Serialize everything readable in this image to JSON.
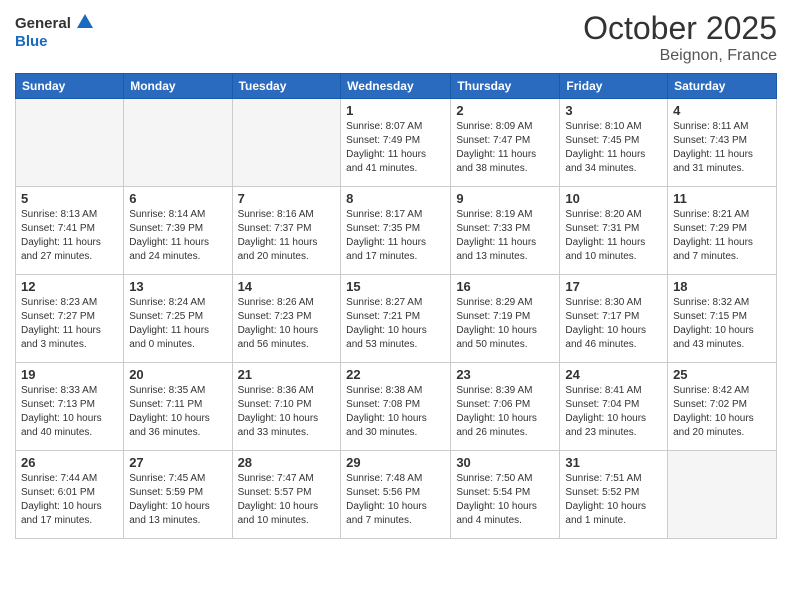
{
  "header": {
    "logo_line1": "General",
    "logo_line2": "Blue",
    "month_title": "October 2025",
    "location": "Beignon, France"
  },
  "days_of_week": [
    "Sunday",
    "Monday",
    "Tuesday",
    "Wednesday",
    "Thursday",
    "Friday",
    "Saturday"
  ],
  "weeks": [
    [
      {
        "day": "",
        "info": ""
      },
      {
        "day": "",
        "info": ""
      },
      {
        "day": "",
        "info": ""
      },
      {
        "day": "1",
        "info": "Sunrise: 8:07 AM\nSunset: 7:49 PM\nDaylight: 11 hours\nand 41 minutes."
      },
      {
        "day": "2",
        "info": "Sunrise: 8:09 AM\nSunset: 7:47 PM\nDaylight: 11 hours\nand 38 minutes."
      },
      {
        "day": "3",
        "info": "Sunrise: 8:10 AM\nSunset: 7:45 PM\nDaylight: 11 hours\nand 34 minutes."
      },
      {
        "day": "4",
        "info": "Sunrise: 8:11 AM\nSunset: 7:43 PM\nDaylight: 11 hours\nand 31 minutes."
      }
    ],
    [
      {
        "day": "5",
        "info": "Sunrise: 8:13 AM\nSunset: 7:41 PM\nDaylight: 11 hours\nand 27 minutes."
      },
      {
        "day": "6",
        "info": "Sunrise: 8:14 AM\nSunset: 7:39 PM\nDaylight: 11 hours\nand 24 minutes."
      },
      {
        "day": "7",
        "info": "Sunrise: 8:16 AM\nSunset: 7:37 PM\nDaylight: 11 hours\nand 20 minutes."
      },
      {
        "day": "8",
        "info": "Sunrise: 8:17 AM\nSunset: 7:35 PM\nDaylight: 11 hours\nand 17 minutes."
      },
      {
        "day": "9",
        "info": "Sunrise: 8:19 AM\nSunset: 7:33 PM\nDaylight: 11 hours\nand 13 minutes."
      },
      {
        "day": "10",
        "info": "Sunrise: 8:20 AM\nSunset: 7:31 PM\nDaylight: 11 hours\nand 10 minutes."
      },
      {
        "day": "11",
        "info": "Sunrise: 8:21 AM\nSunset: 7:29 PM\nDaylight: 11 hours\nand 7 minutes."
      }
    ],
    [
      {
        "day": "12",
        "info": "Sunrise: 8:23 AM\nSunset: 7:27 PM\nDaylight: 11 hours\nand 3 minutes."
      },
      {
        "day": "13",
        "info": "Sunrise: 8:24 AM\nSunset: 7:25 PM\nDaylight: 11 hours\nand 0 minutes."
      },
      {
        "day": "14",
        "info": "Sunrise: 8:26 AM\nSunset: 7:23 PM\nDaylight: 10 hours\nand 56 minutes."
      },
      {
        "day": "15",
        "info": "Sunrise: 8:27 AM\nSunset: 7:21 PM\nDaylight: 10 hours\nand 53 minutes."
      },
      {
        "day": "16",
        "info": "Sunrise: 8:29 AM\nSunset: 7:19 PM\nDaylight: 10 hours\nand 50 minutes."
      },
      {
        "day": "17",
        "info": "Sunrise: 8:30 AM\nSunset: 7:17 PM\nDaylight: 10 hours\nand 46 minutes."
      },
      {
        "day": "18",
        "info": "Sunrise: 8:32 AM\nSunset: 7:15 PM\nDaylight: 10 hours\nand 43 minutes."
      }
    ],
    [
      {
        "day": "19",
        "info": "Sunrise: 8:33 AM\nSunset: 7:13 PM\nDaylight: 10 hours\nand 40 minutes."
      },
      {
        "day": "20",
        "info": "Sunrise: 8:35 AM\nSunset: 7:11 PM\nDaylight: 10 hours\nand 36 minutes."
      },
      {
        "day": "21",
        "info": "Sunrise: 8:36 AM\nSunset: 7:10 PM\nDaylight: 10 hours\nand 33 minutes."
      },
      {
        "day": "22",
        "info": "Sunrise: 8:38 AM\nSunset: 7:08 PM\nDaylight: 10 hours\nand 30 minutes."
      },
      {
        "day": "23",
        "info": "Sunrise: 8:39 AM\nSunset: 7:06 PM\nDaylight: 10 hours\nand 26 minutes."
      },
      {
        "day": "24",
        "info": "Sunrise: 8:41 AM\nSunset: 7:04 PM\nDaylight: 10 hours\nand 23 minutes."
      },
      {
        "day": "25",
        "info": "Sunrise: 8:42 AM\nSunset: 7:02 PM\nDaylight: 10 hours\nand 20 minutes."
      }
    ],
    [
      {
        "day": "26",
        "info": "Sunrise: 7:44 AM\nSunset: 6:01 PM\nDaylight: 10 hours\nand 17 minutes."
      },
      {
        "day": "27",
        "info": "Sunrise: 7:45 AM\nSunset: 5:59 PM\nDaylight: 10 hours\nand 13 minutes."
      },
      {
        "day": "28",
        "info": "Sunrise: 7:47 AM\nSunset: 5:57 PM\nDaylight: 10 hours\nand 10 minutes."
      },
      {
        "day": "29",
        "info": "Sunrise: 7:48 AM\nSunset: 5:56 PM\nDaylight: 10 hours\nand 7 minutes."
      },
      {
        "day": "30",
        "info": "Sunrise: 7:50 AM\nSunset: 5:54 PM\nDaylight: 10 hours\nand 4 minutes."
      },
      {
        "day": "31",
        "info": "Sunrise: 7:51 AM\nSunset: 5:52 PM\nDaylight: 10 hours\nand 1 minute."
      },
      {
        "day": "",
        "info": ""
      }
    ]
  ]
}
